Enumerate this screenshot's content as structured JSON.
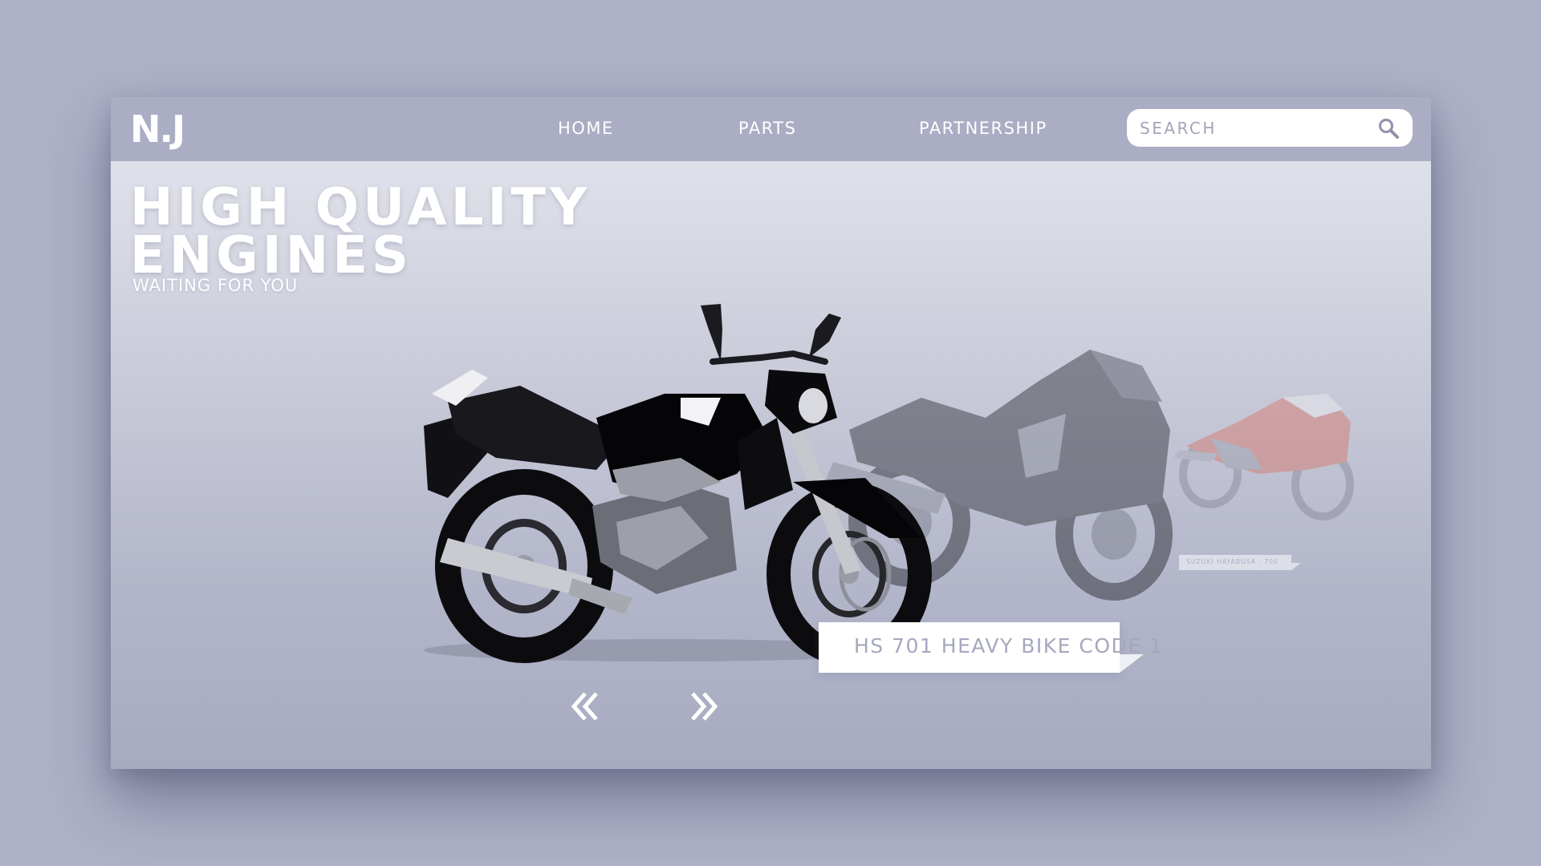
{
  "nav": {
    "logo": "N.J",
    "links": [
      {
        "label": "HOME"
      },
      {
        "label": "PARTS"
      },
      {
        "label": "PARTNERSHIP"
      }
    ],
    "search_placeholder": "SEARCH"
  },
  "hero": {
    "headline_line1": "HIGH QUALITY",
    "headline_line2": "ENGINES",
    "subheadline": "WAITING FOR YOU",
    "featured_label": "HS 701  HEAVY BIKE CODE 1",
    "secondary_label": "SUZUKI HAYABUSA · 700"
  },
  "icons": {
    "search": "search-icon",
    "prev": "double-chevron-left-icon",
    "next": "double-chevron-right-icon"
  },
  "colors": {
    "page_background": "#aeb1c7",
    "nav_background": "#aaadc3",
    "label_text": "#a5a8bd",
    "accent_bike": "#e0543a"
  }
}
